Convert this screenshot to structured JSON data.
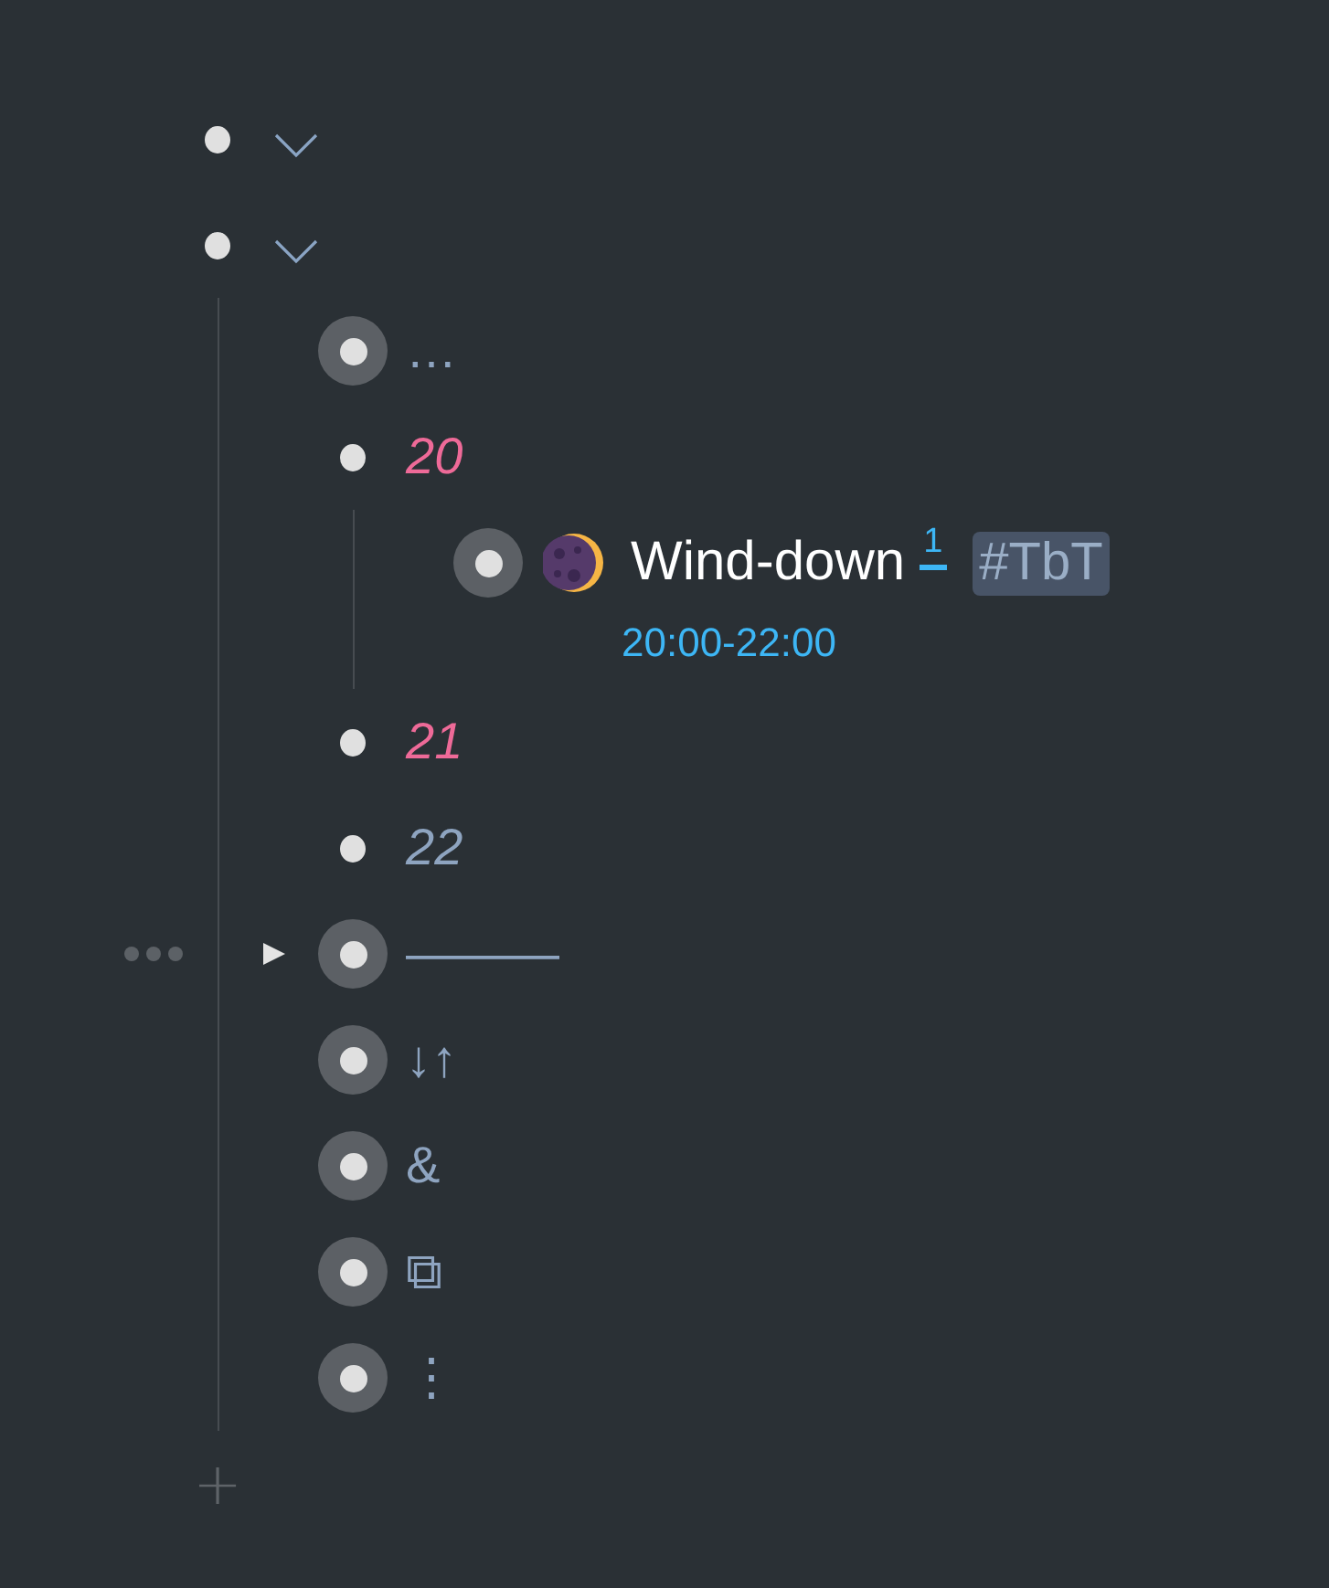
{
  "outline": [
    {
      "kind": "root",
      "expanded": true,
      "collapsed": false,
      "hovered": false
    },
    {
      "kind": "root",
      "expanded": true,
      "collapsed": false,
      "hovered": false,
      "children": [
        {
          "kind": "text",
          "text": "…",
          "color": "#8ea4c0",
          "italic": false,
          "collapsed": true,
          "hovered": false
        },
        {
          "kind": "text",
          "text": "20",
          "color": "#ee6a98",
          "italic": true,
          "collapsed": false,
          "hovered": false,
          "children": [
            {
              "kind": "task",
              "text": "Wind-down",
              "footnote": "1",
              "tag": "#TbT",
              "time": "20:00-22:00",
              "collapsed": true,
              "hovered": false
            }
          ]
        },
        {
          "kind": "text",
          "text": "21",
          "color": "#ee6a98",
          "italic": true,
          "collapsed": false,
          "hovered": false
        },
        {
          "kind": "text",
          "text": "22",
          "color": "#8ea4c0",
          "italic": true,
          "collapsed": false,
          "hovered": false
        },
        {
          "kind": "text",
          "text": "———",
          "color": "#8ea4c0",
          "italic": false,
          "collapsed": true,
          "hovered": true
        },
        {
          "kind": "text",
          "text": "↓↑",
          "color": "#8ea4c0",
          "italic": false,
          "collapsed": true,
          "hovered": false
        },
        {
          "kind": "text",
          "text": "&",
          "color": "#8ea4c0",
          "italic": false,
          "collapsed": true,
          "hovered": false
        },
        {
          "kind": "text",
          "text": "⧉",
          "color": "#8ea4c0",
          "italic": false,
          "collapsed": true,
          "hovered": false
        },
        {
          "kind": "text",
          "text": "⋮",
          "color": "#8ea4c0",
          "italic": false,
          "collapsed": true,
          "hovered": false
        }
      ]
    }
  ],
  "add_button": "+"
}
